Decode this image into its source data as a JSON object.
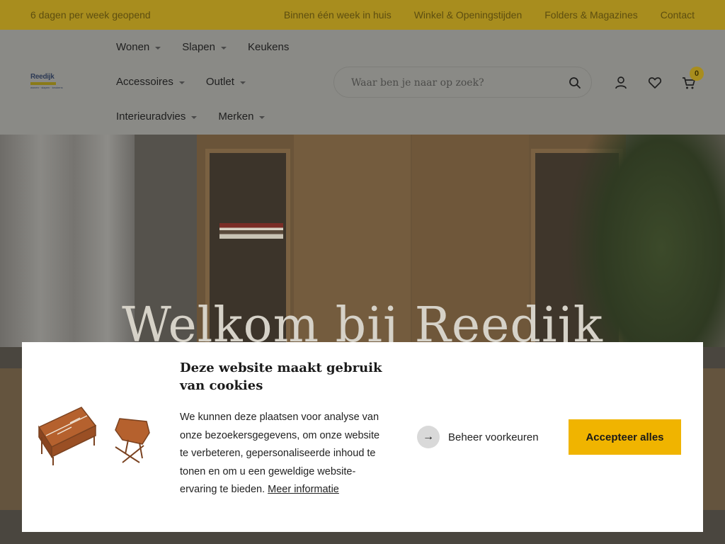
{
  "topbar": {
    "tagline": "6 dagen per week geopend",
    "links": [
      "Binnen één week in huis",
      "Winkel & Openingstijden",
      "Folders & Magazines",
      "Contact"
    ]
  },
  "header": {
    "logo": {
      "name": "Reedijk",
      "tag": "wonen · slapen · keukens"
    },
    "nav_rows": [
      [
        {
          "label": "Wonen",
          "dropdown": true
        },
        {
          "label": "Slapen",
          "dropdown": true
        },
        {
          "label": "Keukens",
          "dropdown": false
        }
      ],
      [
        {
          "label": "Accessoires",
          "dropdown": true
        },
        {
          "label": "Outlet",
          "dropdown": true
        }
      ],
      [
        {
          "label": "Interieuradvies",
          "dropdown": true
        },
        {
          "label": "Merken",
          "dropdown": true
        }
      ]
    ],
    "search": {
      "placeholder": "Waar ben je naar op zoek?",
      "value": ""
    },
    "icons": [
      "account-icon",
      "heart-icon",
      "cart-icon"
    ],
    "cart_count": "0"
  },
  "hero": {
    "title": "Welkom bij Reedijk"
  },
  "cookie": {
    "title": "Deze website maakt gebruik van cookies",
    "text": "We kunnen deze plaatsen voor analyse van onze bezoekersgegevens, om onze website te verbeteren, gepersonaliseerde inhoud te tonen en om u een geweldige website-ervaring te bieden.",
    "more_link": "Meer informatie",
    "manage_label": "Beheer voorkeuren",
    "accept_label": "Accepteer alles"
  },
  "colors": {
    "accent": "#f0b400",
    "topbar": "#a88d1e"
  }
}
